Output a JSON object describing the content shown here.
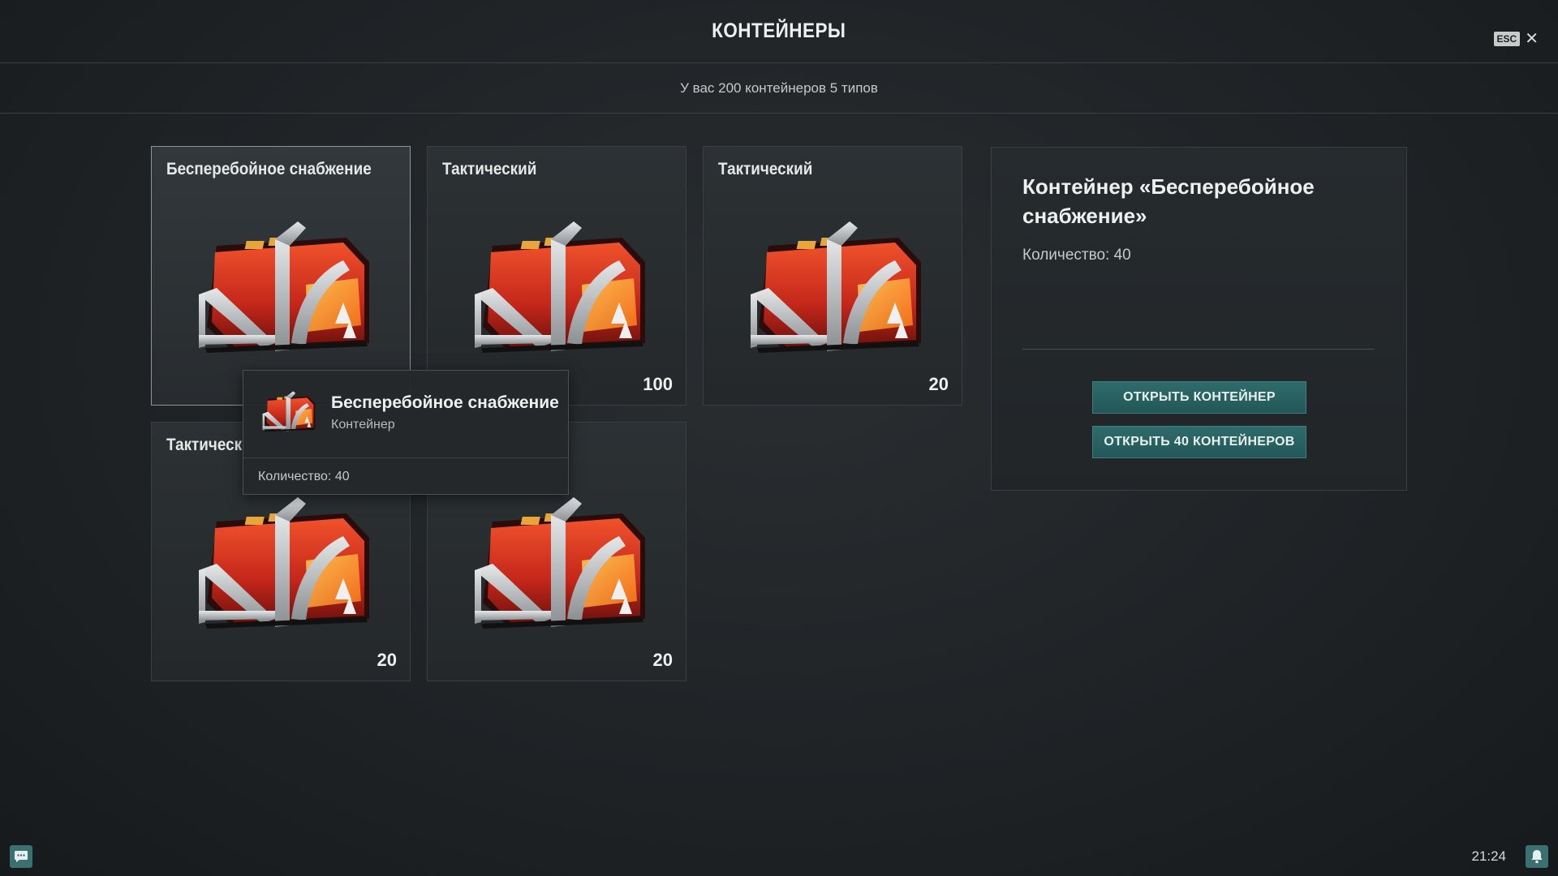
{
  "header": {
    "title": "КОНТЕЙНЕРЫ",
    "esc_label": "ESC",
    "close_glyph": "✕"
  },
  "subheader": {
    "text": "У вас 200 контейнеров 5 типов"
  },
  "cards": [
    {
      "title": "Бесперебойное снабжение",
      "count": "",
      "selected": true
    },
    {
      "title": "Тактический",
      "count": "100"
    },
    {
      "title": "Тактический",
      "count": "20"
    },
    {
      "title": "Тактическ",
      "count": "20"
    },
    {
      "title": "",
      "count": "20"
    }
  ],
  "details": {
    "title": "Контейнер «Бесперебойное снабжение»",
    "quantity": "Количество: 40",
    "open_one_label": "ОТКРЫТЬ КОНТЕЙНЕР",
    "open_all_label": "ОТКРЫТЬ 40 КОНТЕЙНЕРОВ"
  },
  "tooltip": {
    "title": "Бесперебойное снабжение",
    "subtitle": "Контейнер",
    "quantity": "Количество: 40"
  },
  "footer": {
    "clock": "21:24",
    "chat_icon": "chat-icon",
    "bell_icon": "bell-icon"
  },
  "colors": {
    "accent": "#2f6b6b",
    "crate_red": "#d9361f",
    "crate_frame": "#b9bcbd"
  }
}
